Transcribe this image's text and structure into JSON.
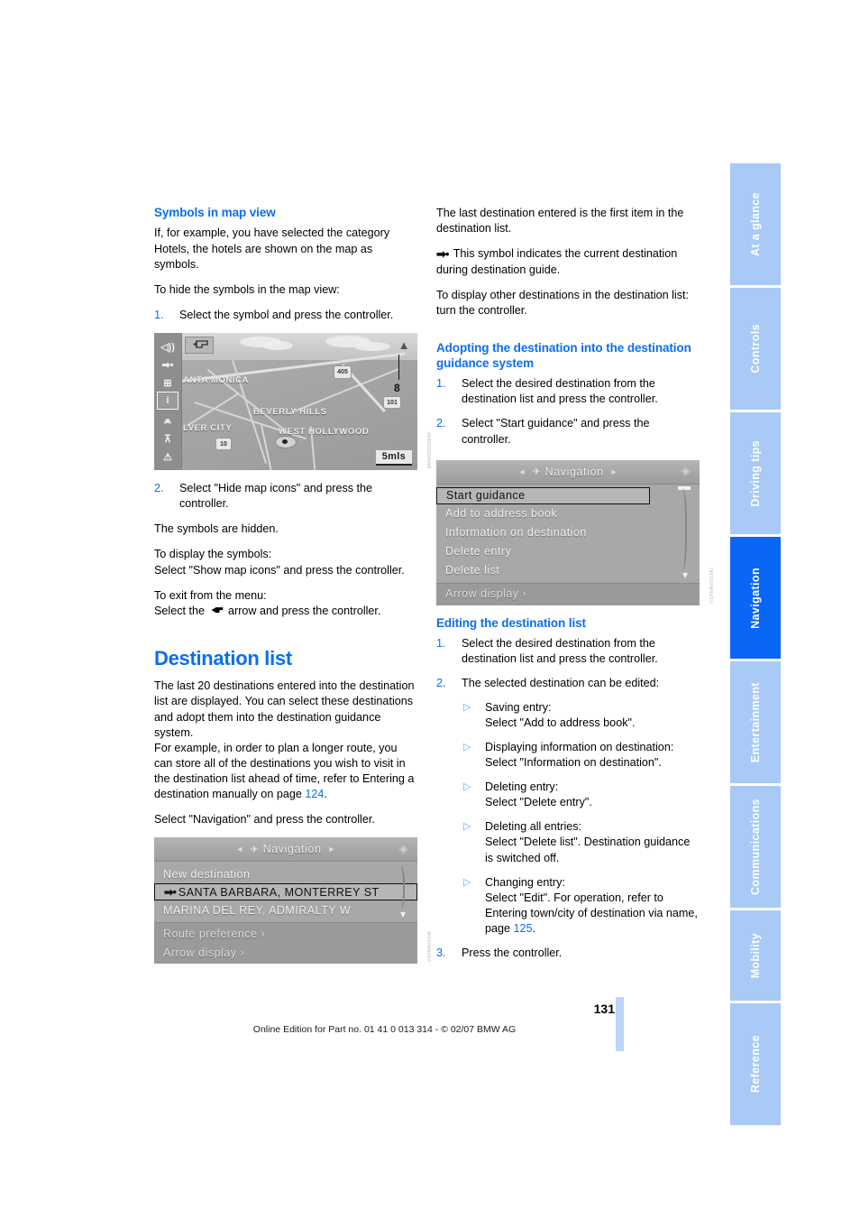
{
  "document": {
    "page_number": "131",
    "imprint": "Online Edition for Part no. 01 41 0 013 314 - © 02/07 BMW AG"
  },
  "tabs": [
    {
      "label": "At a glance",
      "active": false
    },
    {
      "label": "Controls",
      "active": false
    },
    {
      "label": "Driving tips",
      "active": false
    },
    {
      "label": "Navigation",
      "active": true
    },
    {
      "label": "Entertainment",
      "active": false
    },
    {
      "label": "Communications",
      "active": false
    },
    {
      "label": "Mobility",
      "active": false
    },
    {
      "label": "Reference",
      "active": false
    }
  ],
  "left_column": {
    "heading_symbols": "Symbols in map view",
    "p1": "If, for example, you have selected the category Hotels, the hotels are shown on the map as symbols.",
    "p2": "To hide the symbols in the map view:",
    "step1_num": "1.",
    "step1": "Select the symbol and press the controller.",
    "step2_num": "2.",
    "step2": "Select \"Hide map icons\" and press the controller.",
    "p3": "The symbols are hidden.",
    "p4a": "To display the symbols:",
    "p4b": "Select \"Show map icons\" and press the controller.",
    "p5a": "To exit from the menu:",
    "p5b_before": "Select the ",
    "p5b_after": " arrow and press the controller.",
    "chapter_title": "Destination list",
    "p6": "The last 20 destinations entered into the destination list are displayed. You can select these destinations and adopt them into the destination guidance system.",
    "p7_before": "For example, in order to plan a longer route, you can store all of the destinations you wish to visit in the destination list ahead of time, refer to Entering a destination manually on page ",
    "p7_pageref": "124",
    "p7_after": ".",
    "p8": "Select \"Navigation\" and press the controller."
  },
  "right_column": {
    "p1": "The last destination entered is the first item in the destination list.",
    "p2_symbol": "➡•",
    "p2": " This symbol indicates the current destination during destination guide.",
    "p3a": "To display other destinations in the destination list:",
    "p3b": "turn the controller.",
    "heading_adopting": "Adopting the destination into the destination guidance system",
    "adopt_step1_num": "1.",
    "adopt_step1": "Select the desired destination from the destination list and press the controller.",
    "adopt_step2_num": "2.",
    "adopt_step2": "Select \"Start guidance\" and press the controller.",
    "heading_editing": "Editing the destination list",
    "edit_step1_num": "1.",
    "edit_step1": "Select the desired destination from the destination list and press the controller.",
    "edit_step2_num": "2.",
    "edit_step2": "The selected destination can be edited:",
    "subs": [
      {
        "title": "Saving entry:",
        "body": "Select \"Add to address book\"."
      },
      {
        "title": "Displaying information on destination:",
        "body": "Select \"Information on destination\"."
      },
      {
        "title": "Deleting entry:",
        "body": "Select \"Delete entry\"."
      },
      {
        "title": "Deleting all entries:",
        "body": "Select \"Delete list\". Destination guidance is switched off."
      },
      {
        "title": "Changing entry:",
        "body_before": "Select \"Edit\". For operation, refer to Entering town/city of destination via name, page ",
        "pageref": "125",
        "body_after": "."
      }
    ],
    "edit_step3_num": "3.",
    "edit_step3": "Press the controller."
  },
  "figure_map": {
    "caption_code": "BMW0302DMAP",
    "icons": [
      {
        "name": "volume-icon",
        "glyph": "◁))"
      },
      {
        "name": "arrow-destination-icon",
        "glyph": "➡•"
      },
      {
        "name": "map-icons-icon",
        "glyph": "⊞"
      },
      {
        "name": "info-icon",
        "glyph": "i",
        "selected": true
      },
      {
        "name": "road-icon",
        "glyph": "⩕"
      },
      {
        "name": "junction-icon",
        "glyph": "⊼"
      },
      {
        "name": "warning-icon",
        "glyph": "⚠"
      }
    ],
    "cities": [
      "ANTA MONICA",
      "BEVERLY HILLS",
      "LVER CITY",
      "WEST HOLLYWOOD"
    ],
    "shields": [
      "405",
      "101",
      "10"
    ],
    "scale": "5mls",
    "callout": "8",
    "back_button": "back-arrow"
  },
  "figure_nav_menu": {
    "title": "Navigation",
    "caption_code": "VSPNAV0308",
    "items": [
      {
        "label": "New destination",
        "selected": false,
        "prefix": ""
      },
      {
        "label": "SANTA BARBARA, MONTERREY ST",
        "selected": true,
        "prefix": "➡•"
      },
      {
        "label": "MARINA DEL REY, ADMIRALTY W",
        "selected": false,
        "prefix": ""
      }
    ],
    "footer_items": [
      "Route preference ›",
      "Arrow display ›"
    ]
  },
  "figure_dest_menu": {
    "title": "Navigation",
    "caption_code": "VSPNAV0310KI",
    "items": [
      {
        "label": "Start guidance",
        "selected": true
      },
      {
        "label": "Add to address book",
        "selected": false
      },
      {
        "label": "Information on destination",
        "selected": false
      },
      {
        "label": "Delete entry",
        "selected": false
      },
      {
        "label": "Delete list",
        "selected": false
      }
    ],
    "footer_items": [
      "Arrow display ›"
    ]
  },
  "colors": {
    "accent_blue": "#0a6ef0",
    "tab_inactive": "#a9c9f7",
    "tab_active": "#0a66f4"
  }
}
